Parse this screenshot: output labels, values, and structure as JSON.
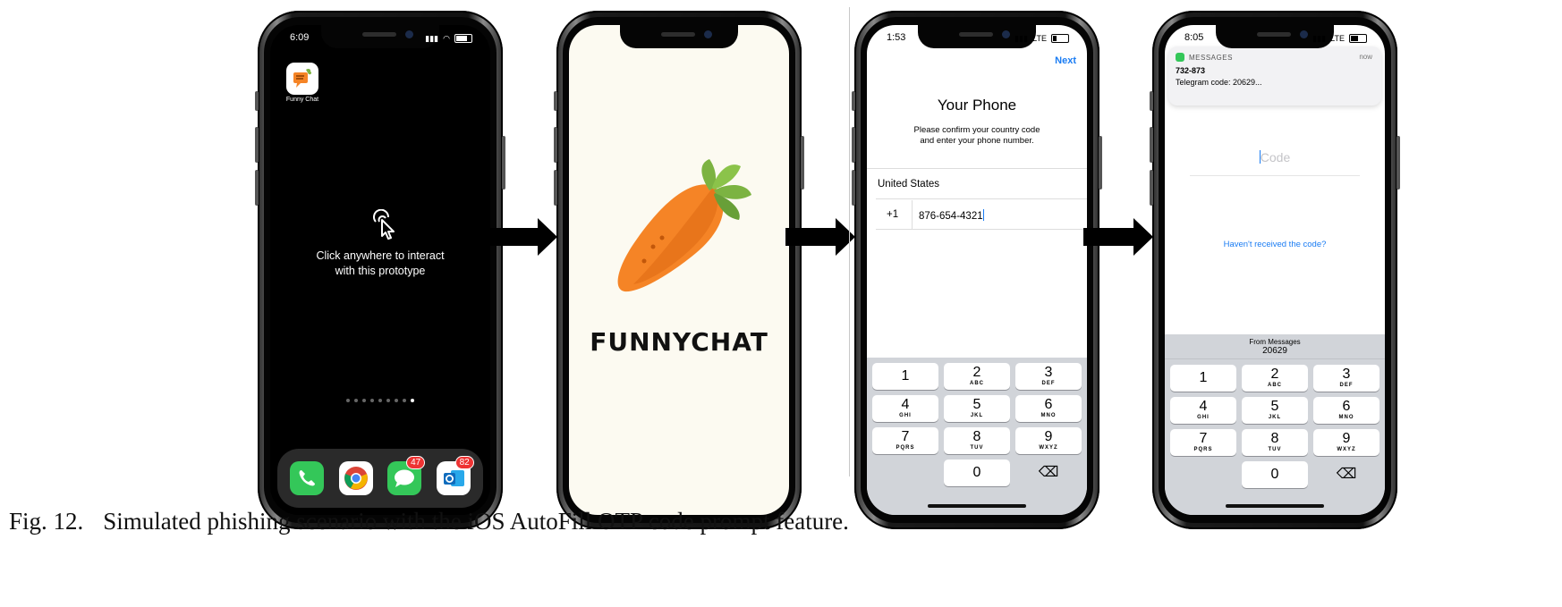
{
  "figure": {
    "caption_label": "Fig. 12.",
    "caption_text": "Simulated phishing scenario with the iOS AutoFill OTP code prompt feature."
  },
  "phone1": {
    "time": "6:09",
    "app_label": "Funny Chat",
    "prompt_line1": "Click anywhere to interact",
    "prompt_line2": "with this prototype",
    "dock": [
      {
        "icon": "phone-icon",
        "color": "#34c759",
        "badge": ""
      },
      {
        "icon": "chrome-icon",
        "color": "#ffffff",
        "badge": ""
      },
      {
        "icon": "messages-icon",
        "color": "#34c759",
        "badge": "47"
      },
      {
        "icon": "outlook-icon",
        "color": "#0f6cbd",
        "badge": "82"
      }
    ]
  },
  "phone2": {
    "brand": "FUNNYCHAT",
    "background": "#fcfaf1"
  },
  "phone3": {
    "time": "1:53",
    "network": "LTE",
    "next_label": "Next",
    "title": "Your Phone",
    "subtitle_line1": "Please confirm your country code",
    "subtitle_line2": "and enter your phone number.",
    "country": "United States",
    "country_code": "+1",
    "phone_number": "876-654-4321"
  },
  "phone4": {
    "time": "8:05",
    "network": "LTE",
    "notif_app": "MESSAGES",
    "notif_time": "now",
    "notif_sender": "732-873",
    "notif_body": "Telegram code: 20629...",
    "code_placeholder": "Code",
    "resend_label": "Haven't received the code?",
    "suggest_from": "From Messages",
    "suggest_code": "20629"
  },
  "keypad": [
    {
      "d": "1",
      "l": ""
    },
    {
      "d": "2",
      "l": "ABC"
    },
    {
      "d": "3",
      "l": "DEF"
    },
    {
      "d": "4",
      "l": "GHI"
    },
    {
      "d": "5",
      "l": "JKL"
    },
    {
      "d": "6",
      "l": "MNO"
    },
    {
      "d": "7",
      "l": "PQRS"
    },
    {
      "d": "8",
      "l": "TUV"
    },
    {
      "d": "9",
      "l": "WXYZ"
    },
    {
      "d": "",
      "l": ""
    },
    {
      "d": "0",
      "l": ""
    },
    {
      "d": "⌫",
      "l": ""
    }
  ],
  "colors": {
    "ios_blue": "#1a7cf3",
    "carrot": "#f58426",
    "leaf": "#7cb342"
  }
}
